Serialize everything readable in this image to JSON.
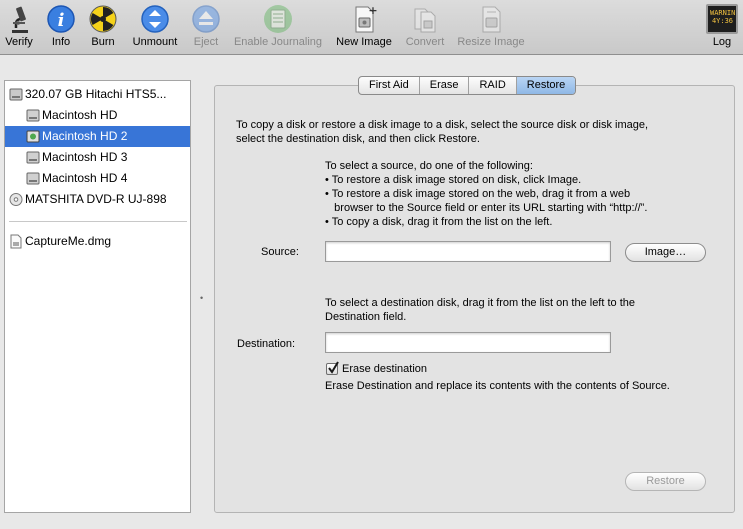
{
  "toolbar": {
    "items": [
      {
        "label": "Verify",
        "icon": "microscope-icon",
        "enabled": true
      },
      {
        "label": "Info",
        "icon": "info-icon",
        "enabled": true
      },
      {
        "label": "Burn",
        "icon": "burn-radiation-icon",
        "enabled": true
      },
      {
        "label": "Unmount",
        "icon": "unmount-icon",
        "enabled": true
      },
      {
        "label": "Eject",
        "icon": "eject-icon",
        "enabled": false
      },
      {
        "label": "Enable Journaling",
        "icon": "journaling-icon",
        "enabled": false
      },
      {
        "label": "New Image",
        "icon": "new-image-icon",
        "enabled": true
      },
      {
        "label": "Convert",
        "icon": "convert-icon",
        "enabled": false
      },
      {
        "label": "Resize Image",
        "icon": "resize-image-icon",
        "enabled": false
      },
      {
        "label": "Log",
        "icon": "log-console-icon",
        "enabled": true
      }
    ],
    "log_icon_text": "WARNIN\n4Y:36"
  },
  "sidebar": {
    "items": [
      {
        "label": "320.07 GB Hitachi HTS5...",
        "icon": "hard-drive-icon",
        "selected": false
      },
      {
        "label": "Macintosh HD",
        "icon": "volume-icon",
        "selected": false
      },
      {
        "label": "Macintosh HD 2",
        "icon": "volume-icon",
        "selected": true
      },
      {
        "label": "Macintosh HD 3",
        "icon": "volume-icon",
        "selected": false
      },
      {
        "label": "Macintosh HD 4",
        "icon": "volume-icon",
        "selected": false
      },
      {
        "label": "MATSHITA DVD-R UJ-898",
        "icon": "optical-drive-icon",
        "selected": false
      },
      {
        "label": "CaptureMe.dmg",
        "icon": "disk-image-file-icon",
        "selected": false
      }
    ]
  },
  "tabs": [
    {
      "label": "First Aid",
      "active": false
    },
    {
      "label": "Erase",
      "active": false
    },
    {
      "label": "RAID",
      "active": false
    },
    {
      "label": "Restore",
      "active": true
    }
  ],
  "restore": {
    "intro_line1": "To copy a disk or restore a disk image to a disk, select the source disk or disk image,",
    "intro_line2": "select the destination disk, and then click Restore.",
    "source_instructions": {
      "heading": "To select a source, do one of the following:",
      "bullets": [
        "• To restore a disk image stored on disk, click Image.",
        "• To restore a disk image stored on the web, drag it from a web",
        "   browser to the Source field or enter its URL starting with “http://”.",
        "• To copy a disk, drag it from the list on the left."
      ]
    },
    "source_label": "Source:",
    "source_value": "",
    "image_button": "Image…",
    "dest_instructions_line1": "To select a destination disk, drag it from the list on the left to the",
    "dest_instructions_line2": "Destination field.",
    "destination_label": "Destination:",
    "destination_value": "",
    "erase_checkbox_label": "Erase destination",
    "erase_checked": true,
    "erase_description": "Erase Destination and replace its contents with the contents of Source.",
    "restore_button": "Restore"
  },
  "colors": {
    "selection": "#3875d7",
    "active_tab": "#9ec3ec",
    "disabled_text": "#888888"
  }
}
